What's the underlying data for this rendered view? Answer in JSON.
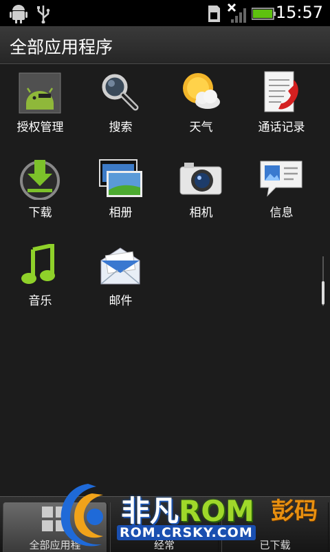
{
  "status_bar": {
    "time": "15:57",
    "icons": [
      "android-debug-icon",
      "usb-icon",
      "sd-card-icon",
      "no-signal-icon",
      "battery-icon"
    ]
  },
  "header": {
    "title": "全部应用程序"
  },
  "apps": [
    {
      "label": "授权管理",
      "icon": "superuser-icon"
    },
    {
      "label": "搜索",
      "icon": "search-icon"
    },
    {
      "label": "天气",
      "icon": "weather-icon"
    },
    {
      "label": "通话记录",
      "icon": "call-log-icon"
    },
    {
      "label": "下载",
      "icon": "download-icon"
    },
    {
      "label": "相册",
      "icon": "gallery-icon"
    },
    {
      "label": "相机",
      "icon": "camera-icon"
    },
    {
      "label": "信息",
      "icon": "messages-icon"
    },
    {
      "label": "音乐",
      "icon": "music-icon"
    },
    {
      "label": "邮件",
      "icon": "mail-icon"
    }
  ],
  "bottom_tabs": [
    {
      "label": "全部应用程",
      "active": true
    },
    {
      "label": "经常",
      "active": false
    },
    {
      "label": "已下载",
      "active": false
    }
  ],
  "watermark": {
    "brand": "非凡",
    "rom": "ROM",
    "site": "ROM.CRSKY.COM",
    "right_text": "彭码"
  },
  "colors": {
    "background": "#1c1c1c",
    "accent_green": "#9fd82a",
    "accent_blue": "#1a4fb0",
    "battery_green": "#5ec10f"
  }
}
